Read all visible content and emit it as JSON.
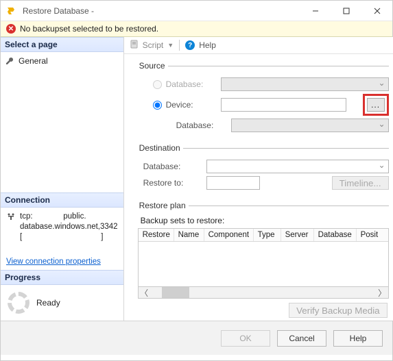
{
  "window": {
    "title": "Restore Database -"
  },
  "error": {
    "message": "No backupset selected to be restored."
  },
  "left": {
    "select_page": "Select a page",
    "pages": [
      {
        "label": "General"
      }
    ],
    "connection_header": "Connection",
    "connection_line1": "tcp:              public.",
    "connection_line2": "database.windows.net,3342",
    "connection_line3": "[                                    ]",
    "view_conn_link": "View connection properties",
    "progress_header": "Progress",
    "progress_status": "Ready"
  },
  "toolbar": {
    "script": "Script",
    "help": "Help"
  },
  "source": {
    "legend": "Source",
    "opt_database": "Database:",
    "opt_device": "Device:",
    "sub_database": "Database:",
    "browse": "..."
  },
  "destination": {
    "legend": "Destination",
    "database": "Database:",
    "restore_to": "Restore to:",
    "timeline": "Timeline..."
  },
  "plan": {
    "legend": "Restore plan",
    "caption": "Backup sets to restore:",
    "columns": [
      "Restore",
      "Name",
      "Component",
      "Type",
      "Server",
      "Database",
      "Posit"
    ],
    "verify": "Verify Backup Media"
  },
  "footer": {
    "ok": "OK",
    "cancel": "Cancel",
    "help": "Help"
  }
}
